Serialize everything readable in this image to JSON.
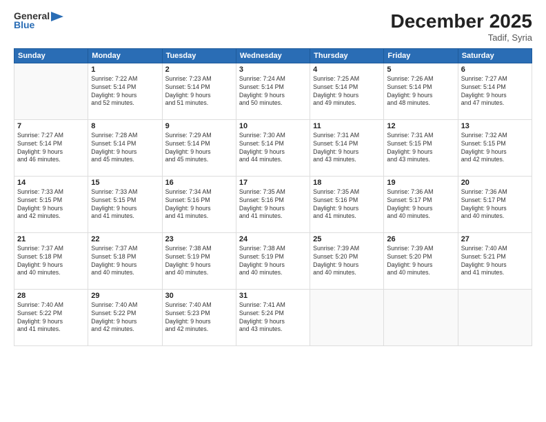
{
  "header": {
    "logo_line1": "General",
    "logo_line2": "Blue",
    "month": "December 2025",
    "location": "Tadif, Syria"
  },
  "weekdays": [
    "Sunday",
    "Monday",
    "Tuesday",
    "Wednesday",
    "Thursday",
    "Friday",
    "Saturday"
  ],
  "weeks": [
    [
      {
        "day": "",
        "info": ""
      },
      {
        "day": "1",
        "info": "Sunrise: 7:22 AM\nSunset: 5:14 PM\nDaylight: 9 hours\nand 52 minutes."
      },
      {
        "day": "2",
        "info": "Sunrise: 7:23 AM\nSunset: 5:14 PM\nDaylight: 9 hours\nand 51 minutes."
      },
      {
        "day": "3",
        "info": "Sunrise: 7:24 AM\nSunset: 5:14 PM\nDaylight: 9 hours\nand 50 minutes."
      },
      {
        "day": "4",
        "info": "Sunrise: 7:25 AM\nSunset: 5:14 PM\nDaylight: 9 hours\nand 49 minutes."
      },
      {
        "day": "5",
        "info": "Sunrise: 7:26 AM\nSunset: 5:14 PM\nDaylight: 9 hours\nand 48 minutes."
      },
      {
        "day": "6",
        "info": "Sunrise: 7:27 AM\nSunset: 5:14 PM\nDaylight: 9 hours\nand 47 minutes."
      }
    ],
    [
      {
        "day": "7",
        "info": "Sunrise: 7:27 AM\nSunset: 5:14 PM\nDaylight: 9 hours\nand 46 minutes."
      },
      {
        "day": "8",
        "info": "Sunrise: 7:28 AM\nSunset: 5:14 PM\nDaylight: 9 hours\nand 45 minutes."
      },
      {
        "day": "9",
        "info": "Sunrise: 7:29 AM\nSunset: 5:14 PM\nDaylight: 9 hours\nand 45 minutes."
      },
      {
        "day": "10",
        "info": "Sunrise: 7:30 AM\nSunset: 5:14 PM\nDaylight: 9 hours\nand 44 minutes."
      },
      {
        "day": "11",
        "info": "Sunrise: 7:31 AM\nSunset: 5:14 PM\nDaylight: 9 hours\nand 43 minutes."
      },
      {
        "day": "12",
        "info": "Sunrise: 7:31 AM\nSunset: 5:15 PM\nDaylight: 9 hours\nand 43 minutes."
      },
      {
        "day": "13",
        "info": "Sunrise: 7:32 AM\nSunset: 5:15 PM\nDaylight: 9 hours\nand 42 minutes."
      }
    ],
    [
      {
        "day": "14",
        "info": "Sunrise: 7:33 AM\nSunset: 5:15 PM\nDaylight: 9 hours\nand 42 minutes."
      },
      {
        "day": "15",
        "info": "Sunrise: 7:33 AM\nSunset: 5:15 PM\nDaylight: 9 hours\nand 41 minutes."
      },
      {
        "day": "16",
        "info": "Sunrise: 7:34 AM\nSunset: 5:16 PM\nDaylight: 9 hours\nand 41 minutes."
      },
      {
        "day": "17",
        "info": "Sunrise: 7:35 AM\nSunset: 5:16 PM\nDaylight: 9 hours\nand 41 minutes."
      },
      {
        "day": "18",
        "info": "Sunrise: 7:35 AM\nSunset: 5:16 PM\nDaylight: 9 hours\nand 41 minutes."
      },
      {
        "day": "19",
        "info": "Sunrise: 7:36 AM\nSunset: 5:17 PM\nDaylight: 9 hours\nand 40 minutes."
      },
      {
        "day": "20",
        "info": "Sunrise: 7:36 AM\nSunset: 5:17 PM\nDaylight: 9 hours\nand 40 minutes."
      }
    ],
    [
      {
        "day": "21",
        "info": "Sunrise: 7:37 AM\nSunset: 5:18 PM\nDaylight: 9 hours\nand 40 minutes."
      },
      {
        "day": "22",
        "info": "Sunrise: 7:37 AM\nSunset: 5:18 PM\nDaylight: 9 hours\nand 40 minutes."
      },
      {
        "day": "23",
        "info": "Sunrise: 7:38 AM\nSunset: 5:19 PM\nDaylight: 9 hours\nand 40 minutes."
      },
      {
        "day": "24",
        "info": "Sunrise: 7:38 AM\nSunset: 5:19 PM\nDaylight: 9 hours\nand 40 minutes."
      },
      {
        "day": "25",
        "info": "Sunrise: 7:39 AM\nSunset: 5:20 PM\nDaylight: 9 hours\nand 40 minutes."
      },
      {
        "day": "26",
        "info": "Sunrise: 7:39 AM\nSunset: 5:20 PM\nDaylight: 9 hours\nand 40 minutes."
      },
      {
        "day": "27",
        "info": "Sunrise: 7:40 AM\nSunset: 5:21 PM\nDaylight: 9 hours\nand 41 minutes."
      }
    ],
    [
      {
        "day": "28",
        "info": "Sunrise: 7:40 AM\nSunset: 5:22 PM\nDaylight: 9 hours\nand 41 minutes."
      },
      {
        "day": "29",
        "info": "Sunrise: 7:40 AM\nSunset: 5:22 PM\nDaylight: 9 hours\nand 42 minutes."
      },
      {
        "day": "30",
        "info": "Sunrise: 7:40 AM\nSunset: 5:23 PM\nDaylight: 9 hours\nand 42 minutes."
      },
      {
        "day": "31",
        "info": "Sunrise: 7:41 AM\nSunset: 5:24 PM\nDaylight: 9 hours\nand 43 minutes."
      },
      {
        "day": "",
        "info": ""
      },
      {
        "day": "",
        "info": ""
      },
      {
        "day": "",
        "info": ""
      }
    ]
  ]
}
